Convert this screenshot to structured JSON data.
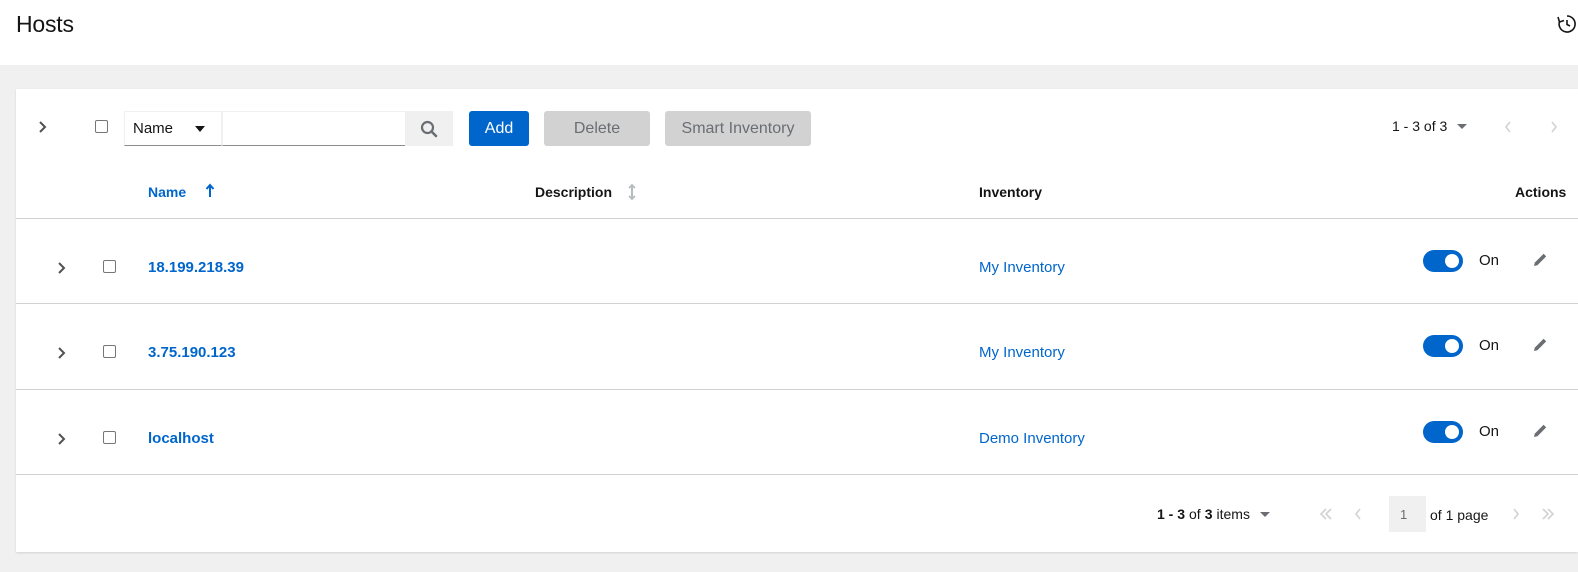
{
  "header": {
    "title": "Hosts",
    "history_icon": "history-icon"
  },
  "toolbar": {
    "filter_field": "Name",
    "search_placeholder": "",
    "search_value": "",
    "add_label": "Add",
    "delete_label": "Delete",
    "smart_inventory_label": "Smart Inventory",
    "pagination_label": "1 - 3 of 3"
  },
  "table": {
    "columns": {
      "name": "Name",
      "description": "Description",
      "inventory": "Inventory",
      "actions": "Actions"
    },
    "rows": [
      {
        "name": "18.199.218.39",
        "description": "",
        "inventory": "My Inventory",
        "enabled_label": "On"
      },
      {
        "name": "3.75.190.123",
        "description": "",
        "inventory": "My Inventory",
        "enabled_label": "On"
      },
      {
        "name": "localhost",
        "description": "",
        "inventory": "Demo Inventory",
        "enabled_label": "On"
      }
    ]
  },
  "pagination": {
    "range": "1 - 3",
    "of": "of",
    "total": "3",
    "items": "items",
    "current_page": "1",
    "of_pages": "of 1 page"
  },
  "colors": {
    "accent": "#0066cc",
    "disabled_bg": "#d2d2d2",
    "page_bg": "#f0f0f0"
  }
}
